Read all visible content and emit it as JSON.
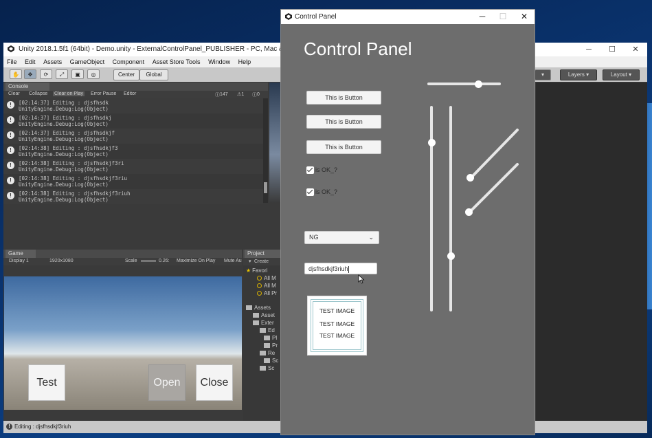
{
  "unity": {
    "title": "Unity 2018.1.5f1 (64bit) - Demo.unity - ExternalControlPanel_PUBLISHER - PC, Mac & Linux S",
    "menu": [
      "File",
      "Edit",
      "Assets",
      "GameObject",
      "Component",
      "Asset Store Tools",
      "Window",
      "Help"
    ],
    "toolbar": {
      "center": "Center",
      "global": "Global",
      "layers": "Layers",
      "layout": "Layout"
    },
    "console": {
      "tab": "Console",
      "bar": {
        "clear": "Clear",
        "collapse": "Collapse",
        "clear_on_play": "Clear on Play",
        "error_pause": "Error Pause",
        "editor": "Editor",
        "count_info": "147",
        "count_warn": "1",
        "count_err": "0"
      },
      "logs": [
        {
          "line1": "[02:14:37] Editing : djsfhsdk",
          "line2": "UnityEngine.Debug:Log(Object)"
        },
        {
          "line1": "[02:14:37] Editing : djsfhsdkj",
          "line2": "UnityEngine.Debug:Log(Object)"
        },
        {
          "line1": "[02:14:37] Editing : djsfhsdkjf",
          "line2": "UnityEngine.Debug:Log(Object)"
        },
        {
          "line1": "[02:14:38] Editing : djsfhsdkjf3",
          "line2": "UnityEngine.Debug:Log(Object)"
        },
        {
          "line1": "[02:14:38] Editing : djsfhsdkjf3ri",
          "line2": "UnityEngine.Debug:Log(Object)"
        },
        {
          "line1": "[02:14:38] Editing : djsfhsdkjf3riu",
          "line2": "UnityEngine.Debug:Log(Object)"
        },
        {
          "line1": "[02:14:38] Editing : djsfhsdkjf3riuh",
          "line2": "UnityEngine.Debug:Log(Object)"
        }
      ]
    },
    "game": {
      "tab": "Game",
      "display": "Display 1",
      "resolution": "1920x1080",
      "scale_label": "Scale",
      "scale_value": "0.26:",
      "maximize": "Maximize On Play",
      "mute": "Mute Au",
      "buttons": {
        "test": "Test",
        "open": "Open",
        "close": "Close"
      }
    },
    "project": {
      "tab": "Project",
      "create": "Create",
      "favorites": "Favori",
      "fav_items": [
        "All M",
        "All M",
        "All Pr"
      ],
      "assets": "Assets",
      "asset_items": [
        "Asset",
        "Exter",
        "Ed",
        "Pl",
        "Pr",
        "Re",
        "Sc",
        "Sc"
      ]
    },
    "status": "Editing : djsfhsdkjf3riuh"
  },
  "control_panel": {
    "window_title": "Control Panel",
    "heading": "Control Panel",
    "buttons": [
      "This is Button",
      "This is Button",
      "This is Button"
    ],
    "checkboxes": [
      {
        "label": "is OK_?",
        "checked": true
      },
      {
        "label": "is OK_?",
        "checked": true
      }
    ],
    "dropdown": {
      "value": "NG"
    },
    "input": {
      "value": "djsfhsdkjf3riuh"
    },
    "image_text": [
      "TEST IMAGE",
      "TEST IMAGE",
      "TEST IMAGE"
    ],
    "sliders": {
      "horizontal": 0.7,
      "vertical_1": 0.82,
      "vertical_2": 0.27,
      "diagonal_1": 0.0,
      "diagonal_2": 0.0
    }
  }
}
